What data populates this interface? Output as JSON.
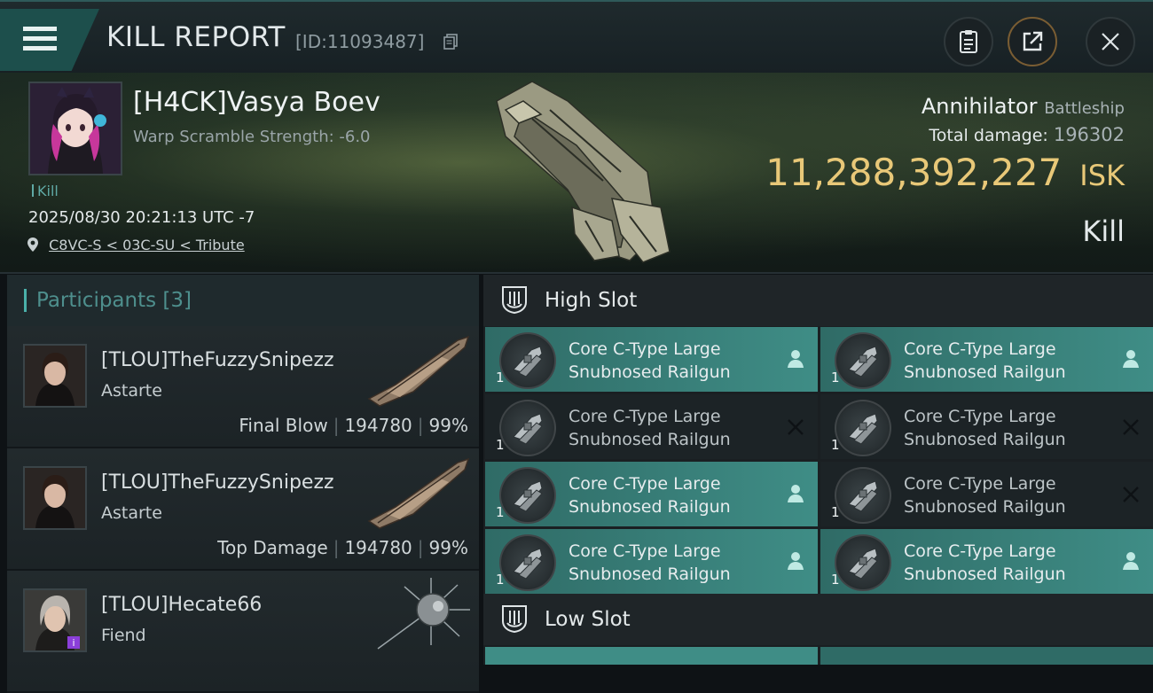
{
  "header": {
    "title": "KILL REPORT",
    "report_id": "[ID:11093487]",
    "buttons": [
      "clipboard",
      "share",
      "close"
    ]
  },
  "victim": {
    "name": "[H4CK]Vasya Boev",
    "warp_scramble": "Warp Scramble Strength: -6.0",
    "tag": "Kill",
    "datetime": "2025/08/30 20:21:13 UTC -7",
    "location": "C8VC-S < 03C-SU < Tribute",
    "ship_name": "Annihilator",
    "ship_class": "Battleship",
    "total_damage_label": "Total damage:",
    "total_damage": "196302",
    "isk_value": "11,288,392,227",
    "isk_unit": "ISK",
    "result": "Kill"
  },
  "participants": {
    "label": "Participants [3]",
    "items": [
      {
        "name": "[TLOU]TheFuzzySnipezz",
        "ship": "Astarte",
        "role": "Final Blow",
        "damage": "194780",
        "percent": "99%"
      },
      {
        "name": "[TLOU]TheFuzzySnipezz",
        "ship": "Astarte",
        "role": "Top Damage",
        "damage": "194780",
        "percent": "99%"
      },
      {
        "name": "[TLOU]Hecate66",
        "ship": "Fiend",
        "role": "",
        "damage": "",
        "percent": ""
      }
    ]
  },
  "slots": {
    "high_label": "High Slot",
    "low_label": "Low Slot",
    "high_items": [
      {
        "line1": "Core C-Type Large",
        "line2": "Snubnosed Railgun",
        "qty": "1",
        "state": "dropped"
      },
      {
        "line1": "Core C-Type Large",
        "line2": "Snubnosed Railgun",
        "qty": "1",
        "state": "dropped"
      },
      {
        "line1": "Core C-Type Large",
        "line2": "Snubnosed Railgun",
        "qty": "1",
        "state": "destroyed"
      },
      {
        "line1": "Core C-Type Large",
        "line2": "Snubnosed Railgun",
        "qty": "1",
        "state": "destroyed"
      },
      {
        "line1": "Core C-Type Large",
        "line2": "Snubnosed Railgun",
        "qty": "1",
        "state": "dropped"
      },
      {
        "line1": "Core C-Type Large",
        "line2": "Snubnosed Railgun",
        "qty": "1",
        "state": "destroyed"
      },
      {
        "line1": "Core C-Type Large",
        "line2": "Snubnosed Railgun",
        "qty": "1",
        "state": "dropped"
      },
      {
        "line1": "Core C-Type Large",
        "line2": "Snubnosed Railgun",
        "qty": "1",
        "state": "dropped"
      }
    ]
  },
  "colors": {
    "accent_teal": "#3f8d86",
    "isk_gold": "#e8c878",
    "background": "#0e1215"
  }
}
